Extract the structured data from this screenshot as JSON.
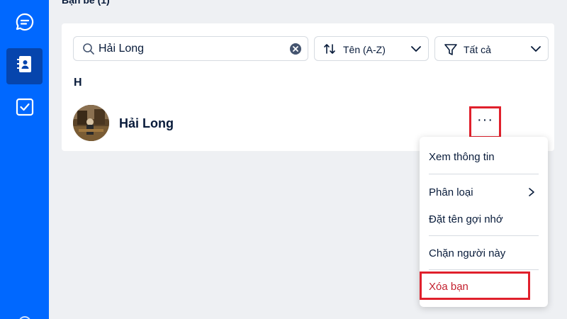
{
  "sidebar": {
    "items": [
      {
        "name": "messages",
        "icon": "chat-bubble-icon",
        "active": false
      },
      {
        "name": "contacts",
        "icon": "contact-book-icon",
        "active": true
      },
      {
        "name": "todo",
        "icon": "checkbox-icon",
        "active": false
      }
    ],
    "accent_color": "#0068ff",
    "active_color": "#0645ad"
  },
  "main": {
    "section_title": "Bạn bè (1)",
    "search": {
      "value": "Hải Long",
      "icon": "search-icon",
      "clear_icon": "clear-circle-icon"
    },
    "sort": {
      "label": "Tên (A-Z)",
      "icon": "sort-arrows-icon"
    },
    "filter": {
      "label": "Tất cả",
      "icon": "funnel-icon"
    },
    "group_letter": "H",
    "contacts": [
      {
        "name": "Hải Long",
        "more_label": "···"
      }
    ]
  },
  "context_menu": {
    "items": [
      {
        "label": "Xem thông tin"
      },
      {
        "label": "Phân loại",
        "has_submenu": true
      },
      {
        "label": "Đặt tên gợi nhớ"
      },
      {
        "label": "Chặn người này"
      },
      {
        "label": "Xóa bạn",
        "danger": true
      }
    ],
    "danger_color": "#c31f2d",
    "highlight_color": "#e0202c"
  }
}
